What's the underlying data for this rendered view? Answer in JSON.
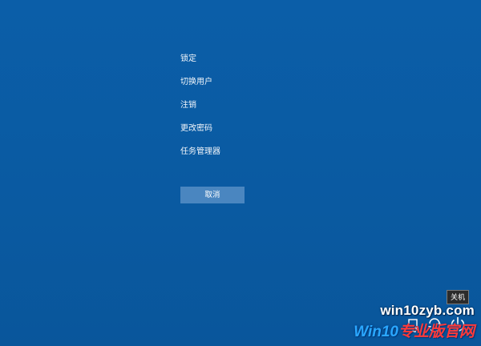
{
  "menu": {
    "items": [
      {
        "label": "锁定"
      },
      {
        "label": "切换用户"
      },
      {
        "label": "注销"
      },
      {
        "label": "更改密码"
      },
      {
        "label": "任务管理器"
      }
    ],
    "cancel_label": "取消"
  },
  "tooltip": {
    "text": "关机"
  },
  "tray": {
    "icons": [
      "network-icon",
      "accessibility-icon",
      "power-icon"
    ]
  },
  "watermark": {
    "domain": "win10zyb.com",
    "brand_win": "Win10",
    "brand_rest": "专业版官网"
  },
  "colors": {
    "background": "#0a5da6",
    "button": "#4a86c0",
    "tooltip_bg": "#2b2b2b",
    "text": "#ffffff"
  }
}
